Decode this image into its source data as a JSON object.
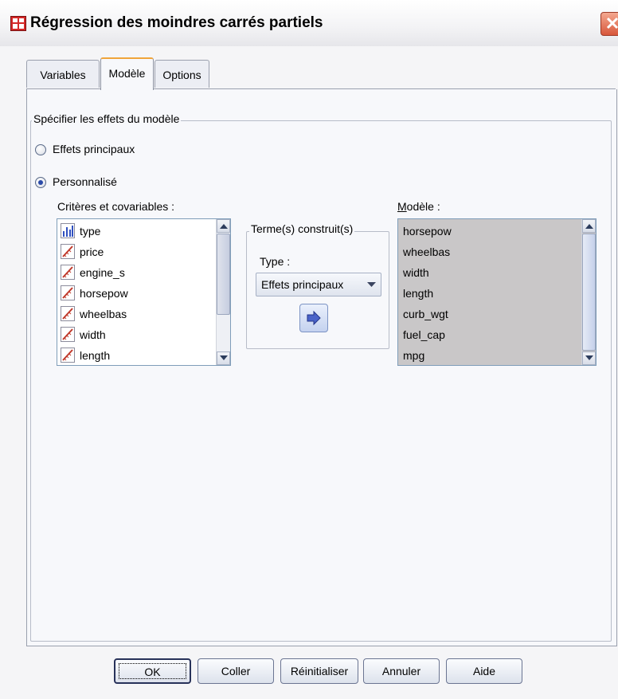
{
  "window": {
    "title": "Régression des moindres carrés partiels",
    "icon": "spss-dialog-icon",
    "close_icon": "close-icon"
  },
  "tabs": [
    {
      "label": "Variables",
      "active": false
    },
    {
      "label": "Modèle",
      "active": true
    },
    {
      "label": "Options",
      "active": false
    }
  ],
  "group": {
    "legend": "Spécifier les effets du modèle",
    "radio_main": {
      "label": "Effets principaux",
      "checked": false
    },
    "radio_custom": {
      "label": "Personnalisé",
      "checked": true
    }
  },
  "factors": {
    "label": "Critères et covariables :",
    "items": [
      {
        "name": "type",
        "icon": "nominal-bars-icon"
      },
      {
        "name": "price",
        "icon": "scale-ruler-icon"
      },
      {
        "name": "engine_s",
        "icon": "scale-ruler-icon"
      },
      {
        "name": "horsepow",
        "icon": "scale-ruler-icon"
      },
      {
        "name": "wheelbas",
        "icon": "scale-ruler-icon"
      },
      {
        "name": "width",
        "icon": "scale-ruler-icon"
      },
      {
        "name": "length",
        "icon": "scale-ruler-icon"
      }
    ]
  },
  "build_terms": {
    "legend": "Terme(s) construit(s)",
    "type_label": "Type :",
    "type_value": "Effets principaux",
    "move_icon": "right-arrow-icon"
  },
  "model": {
    "label": "Modèle :",
    "items": [
      "horsepow",
      "wheelbas",
      "width",
      "length",
      "curb_wgt",
      "fuel_cap",
      "mpg"
    ]
  },
  "buttons": {
    "ok": "OK",
    "paste": "Coller",
    "reset": "Réinitialiser",
    "cancel": "Annuler",
    "help": "Aide"
  },
  "colors": {
    "accent_tab": "#f0a43a",
    "model_bg": "#c9c7c8",
    "arrow_button": "#4a63c8"
  }
}
